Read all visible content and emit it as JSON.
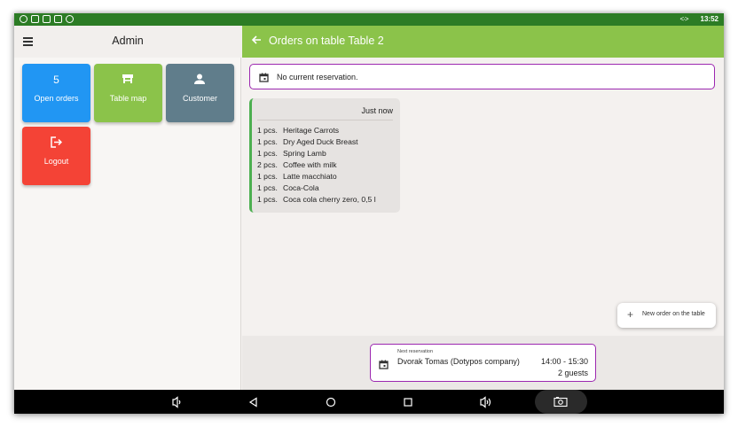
{
  "colors": {
    "statusbar": "#2c7c25",
    "appbar": "#8bc34a",
    "tile_open_orders": "#2196f3",
    "tile_table_map": "#8bc34a",
    "tile_customer": "#607d8b",
    "tile_logout": "#f44336",
    "reservation_border": "#9c27b0",
    "order_accent": "#4caf50"
  },
  "statusbar": {
    "time": "13:52",
    "left_icons": [
      "eye-icon",
      "app-icon",
      "image-icon",
      "app-icon",
      "location-icon"
    ],
    "right_icon": "arrows-icon"
  },
  "left": {
    "title": "Admin",
    "tiles": [
      {
        "value": "5",
        "label": "Open orders",
        "icon": null
      },
      {
        "label": "Table map",
        "icon": "table-icon"
      },
      {
        "label": "Customer",
        "icon": "person-icon"
      },
      {
        "label": "Logout",
        "icon": "logout-icon"
      }
    ]
  },
  "header": {
    "title": "Orders on table Table 2"
  },
  "reservation": {
    "text": "No current reservation."
  },
  "order": {
    "time": "Just now",
    "items": [
      {
        "qty": "1 pcs.",
        "name": "Heritage Carrots"
      },
      {
        "qty": "1 pcs.",
        "name": "Dry Aged Duck Breast"
      },
      {
        "qty": "1 pcs.",
        "name": "Spring Lamb"
      },
      {
        "qty": "2 pcs.",
        "name": "Coffee with milk"
      },
      {
        "qty": "1 pcs.",
        "name": "Latte macchiato"
      },
      {
        "qty": "1 pcs.",
        "name": "Coca-Cola"
      },
      {
        "qty": "1 pcs.",
        "name": "Coca cola cherry zero, 0,5 l"
      }
    ]
  },
  "fab": {
    "label": "New order on the table",
    "icon": "plus-icon"
  },
  "next_reservation": {
    "caption": "Next reservation",
    "name": "Dvorak Tomas (Dotypos company)",
    "time": "14:00 - 15:30",
    "guests": "2 guests"
  },
  "navbar": {
    "icons": [
      "volume-down-icon",
      "back-icon",
      "home-icon",
      "recents-icon",
      "volume-up-icon",
      "screenshot-icon"
    ]
  }
}
